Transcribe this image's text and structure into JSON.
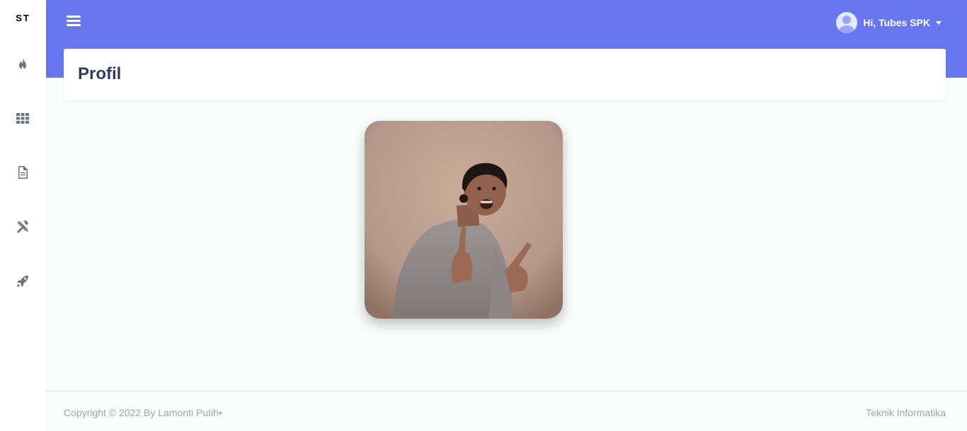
{
  "sidebar": {
    "brand": "ST",
    "items": [
      {
        "icon": "fire-icon"
      },
      {
        "icon": "grid-icon"
      },
      {
        "icon": "file-icon"
      },
      {
        "icon": "tools-icon"
      },
      {
        "icon": "rocket-icon"
      }
    ]
  },
  "navbar": {
    "user_greeting": "Hi, Tubes SPK",
    "accent_color": "#6777ef"
  },
  "section": {
    "title": "Profil"
  },
  "footer": {
    "copyright": "Copyright © 2022  By Lamonti Putih•",
    "right_text": "Teknik Informatika"
  }
}
